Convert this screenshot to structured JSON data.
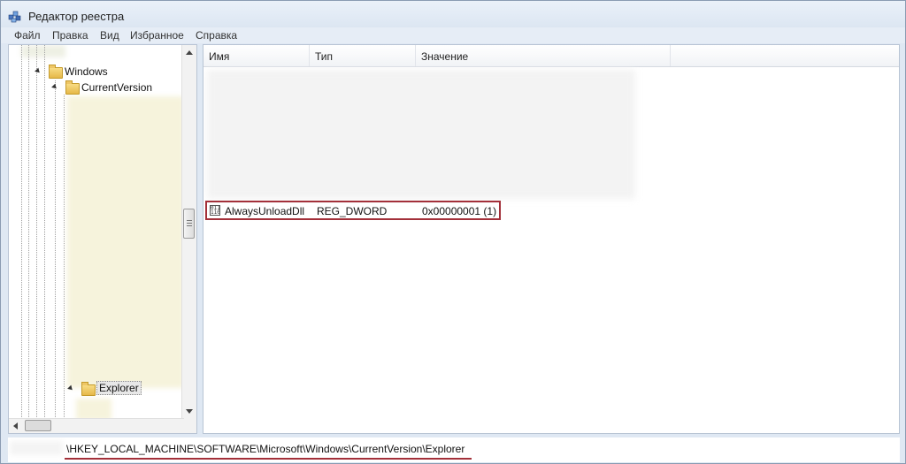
{
  "window": {
    "title": "Редактор реестра",
    "icon": "regedit-icon"
  },
  "menu": {
    "items": [
      "Файл",
      "Правка",
      "Вид",
      "Избранное",
      "Справка"
    ]
  },
  "tree": {
    "nodes": [
      {
        "label": "Windows",
        "icon": "folder-icon",
        "expanded": true
      },
      {
        "label": "CurrentVersion",
        "icon": "folder-icon",
        "expanded": true
      },
      {
        "label": "Explorer",
        "icon": "folder-icon",
        "expanded": true,
        "selected": true
      }
    ]
  },
  "list": {
    "columns": [
      "Имя",
      "Тип",
      "Значение"
    ],
    "rows": [
      {
        "name": "AlwaysUnloadDll",
        "type": "REG_DWORD",
        "value": "0x00000001 (1)",
        "icon": "reg-binary-icon",
        "highlighted": true
      }
    ]
  },
  "status": {
    "path": "\\HKEY_LOCAL_MACHINE\\SOFTWARE\\Microsoft\\Windows\\CurrentVersion\\Explorer"
  },
  "colors": {
    "highlight": "#a3303a",
    "chrome": "#dfe8f3"
  }
}
